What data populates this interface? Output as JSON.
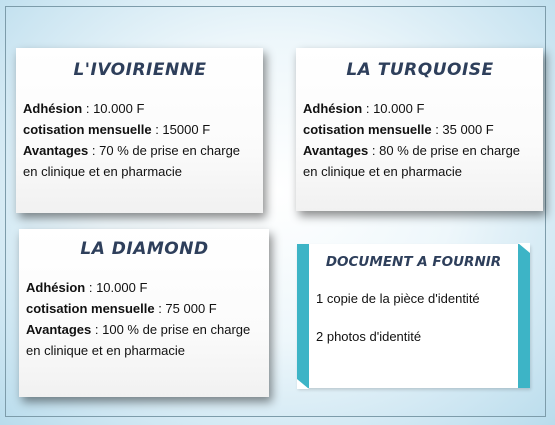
{
  "plans": [
    {
      "title": "L'IVOIRIENNE",
      "adhesion_label": "Adhésion",
      "adhesion_value": " : 10.000 F",
      "cotisation_label": "cotisation mensuelle",
      "cotisation_value": "  : 15000 F",
      "avantages_label": "Avantages",
      "avantages_value": "  : 70 % de prise en charge en clinique et en pharmacie"
    },
    {
      "title": "LA TURQUOISE",
      "adhesion_label": "Adhésion",
      "adhesion_value": " : 10.000 F",
      "cotisation_label": "cotisation mensuelle",
      "cotisation_value": "  : 35 000 F",
      "avantages_label": "Avantages",
      "avantages_value": "  : 80 % de prise en charge en clinique et en pharmacie"
    },
    {
      "title": "LA DIAMOND",
      "adhesion_label": "Adhésion",
      "adhesion_value": " : 10.000 F",
      "cotisation_label": "cotisation mensuelle",
      "cotisation_value": "  : 75 000 F",
      "avantages_label": "Avantages",
      "avantages_value": "  : 100 % de prise en charge en clinique et en pharmacie"
    }
  ],
  "documents": {
    "title": "DOCUMENT A FOURNIR",
    "items": [
      "1 copie de la pièce  d'identité",
      "2 photos d'identité"
    ]
  },
  "colors": {
    "title_text": "#2e3f5b",
    "document_border": "#3db4c6",
    "background_edge": "#b9dcec"
  }
}
